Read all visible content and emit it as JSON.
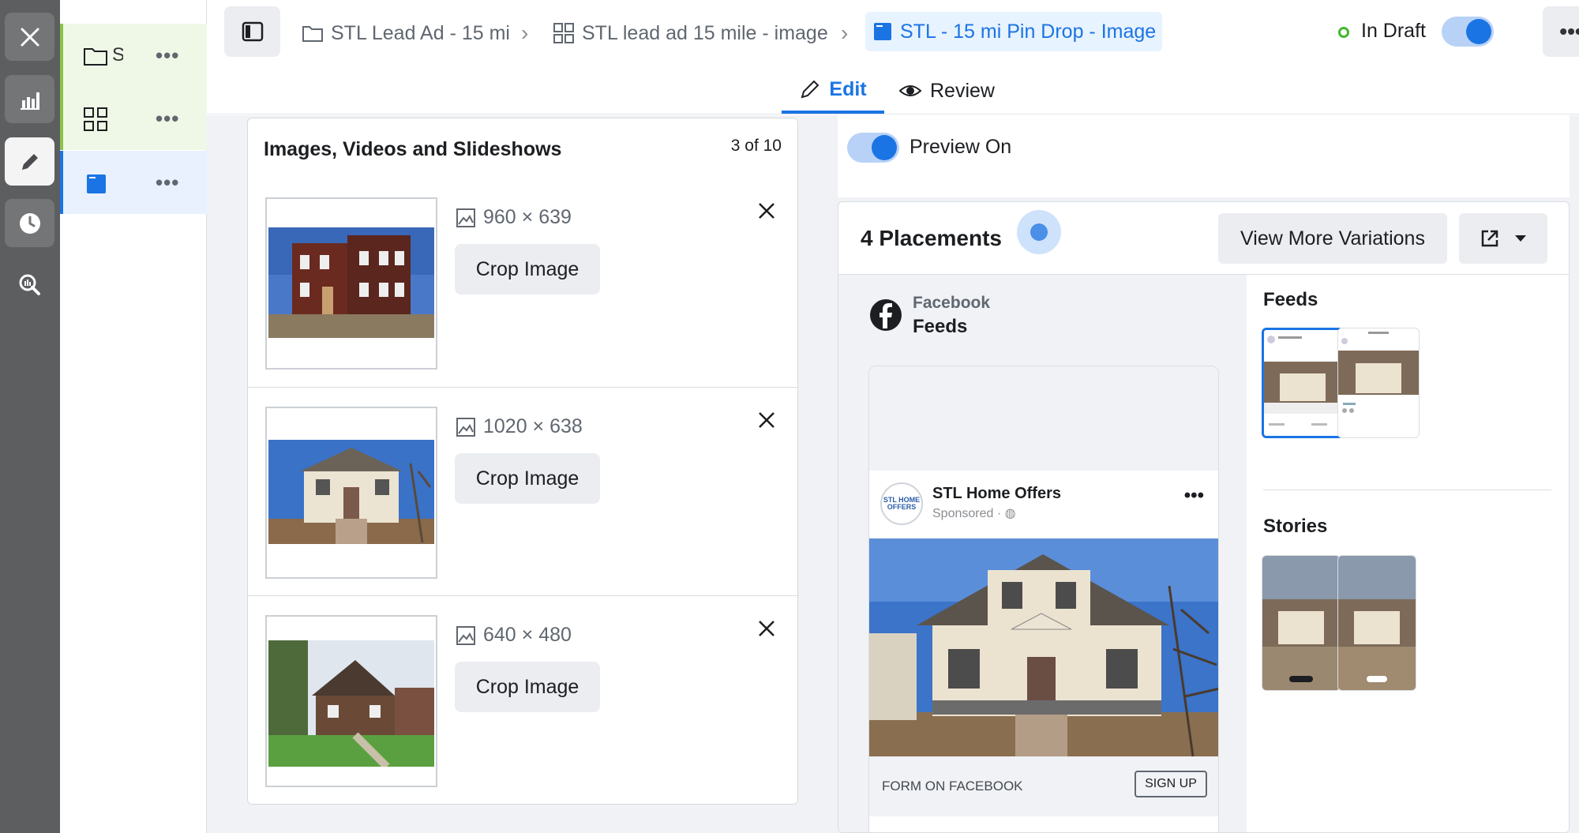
{
  "rail": {
    "buttons": [
      "close-icon",
      "chart-icon",
      "pencil-icon",
      "clock-icon",
      "search-chart-icon"
    ]
  },
  "tree": {
    "items": [
      {
        "label": "S",
        "more": "•••"
      },
      {
        "label": "",
        "more": "•••"
      },
      {
        "label": "",
        "more": "•••"
      }
    ]
  },
  "breadcrumbs": [
    {
      "label": "STL Lead Ad - 15 mi"
    },
    {
      "label": "STL lead ad 15 mile - image"
    },
    {
      "label": "STL - 15 mi Pin Drop - Image"
    }
  ],
  "header": {
    "status": "In Draft",
    "more": "•••",
    "tabs": [
      {
        "label": "Edit"
      },
      {
        "label": "Review"
      }
    ]
  },
  "media": {
    "title": "Images, Videos and Slideshows",
    "count": "3 of 10",
    "items": [
      {
        "dims": "960 × 639",
        "crop_label": "Crop Image"
      },
      {
        "dims": "1020 × 638",
        "crop_label": "Crop Image"
      },
      {
        "dims": "640 × 480",
        "crop_label": "Crop Image"
      }
    ]
  },
  "preview": {
    "toggle_label": "Preview On",
    "placements_title": "4 Placements",
    "more_variations": "View More Variations",
    "platform": "Facebook",
    "placement": "Feeds",
    "ad": {
      "page_name": "STL Home Offers",
      "sponsored": "Sponsored ·",
      "avatar_text": "STL HOME OFFERS",
      "footer_text": "FORM ON FACEBOOK",
      "cta": "SIGN UP",
      "more": "•••"
    },
    "sections": {
      "feeds": "Feeds",
      "stories": "Stories"
    }
  },
  "colors": {
    "accent": "#1b74e4",
    "rail": "#5d5e60",
    "draft_status": "#42b72a"
  }
}
